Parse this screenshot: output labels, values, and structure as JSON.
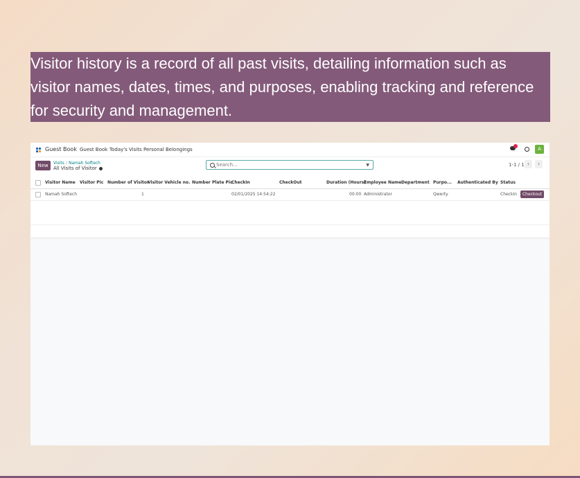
{
  "caption": {
    "line1": "Visitor history is a record of all past visits, detailing information such as",
    "line2": "visitor names, dates, times, and purposes, enabling tracking and reference",
    "line3": "for security and management."
  },
  "topnav": {
    "app_name": "Guest Book",
    "menu": [
      "Guest Book",
      "Today's Visits",
      "Personal Belongings"
    ],
    "avatar_letter": "A"
  },
  "control": {
    "new_label": "New",
    "breadcrumb_parent": "Visits",
    "breadcrumb_sep": "/",
    "breadcrumb_current": "Namah Softech",
    "subtitle": "All Visits of Visitor",
    "search_placeholder": "Search...",
    "pager": "1-1 / 1"
  },
  "table": {
    "headers": [
      "Visitor Name",
      "Visitor Pic",
      "Number of Visitor",
      "Visitor Vehicle no.",
      "Number Plate Pic",
      "CheckIn",
      "CheckOut",
      "Duration (Hours)",
      "Employee Name",
      "Department",
      "Purpo...",
      "Authenticated By",
      "Status"
    ],
    "rows": [
      {
        "visitor_name": "Namah Softech",
        "visitor_pic": "",
        "number_of_visitor": "1",
        "vehicle_no": "",
        "plate_pic": "",
        "checkin": "02/01/2025 14:54:22",
        "checkout": "",
        "duration": "00:00",
        "employee": "Administrator",
        "department": "",
        "purpose": "Qwerty",
        "authenticated_by": "",
        "status": "CheckIn",
        "action": "Checkout"
      }
    ]
  },
  "colors": {
    "brand": "#714b67",
    "caption_bg": "#845a7a",
    "link": "#017e84",
    "search_border": "#5ba9a6",
    "badge": "#e0264b",
    "avatar": "#6cb33f"
  }
}
